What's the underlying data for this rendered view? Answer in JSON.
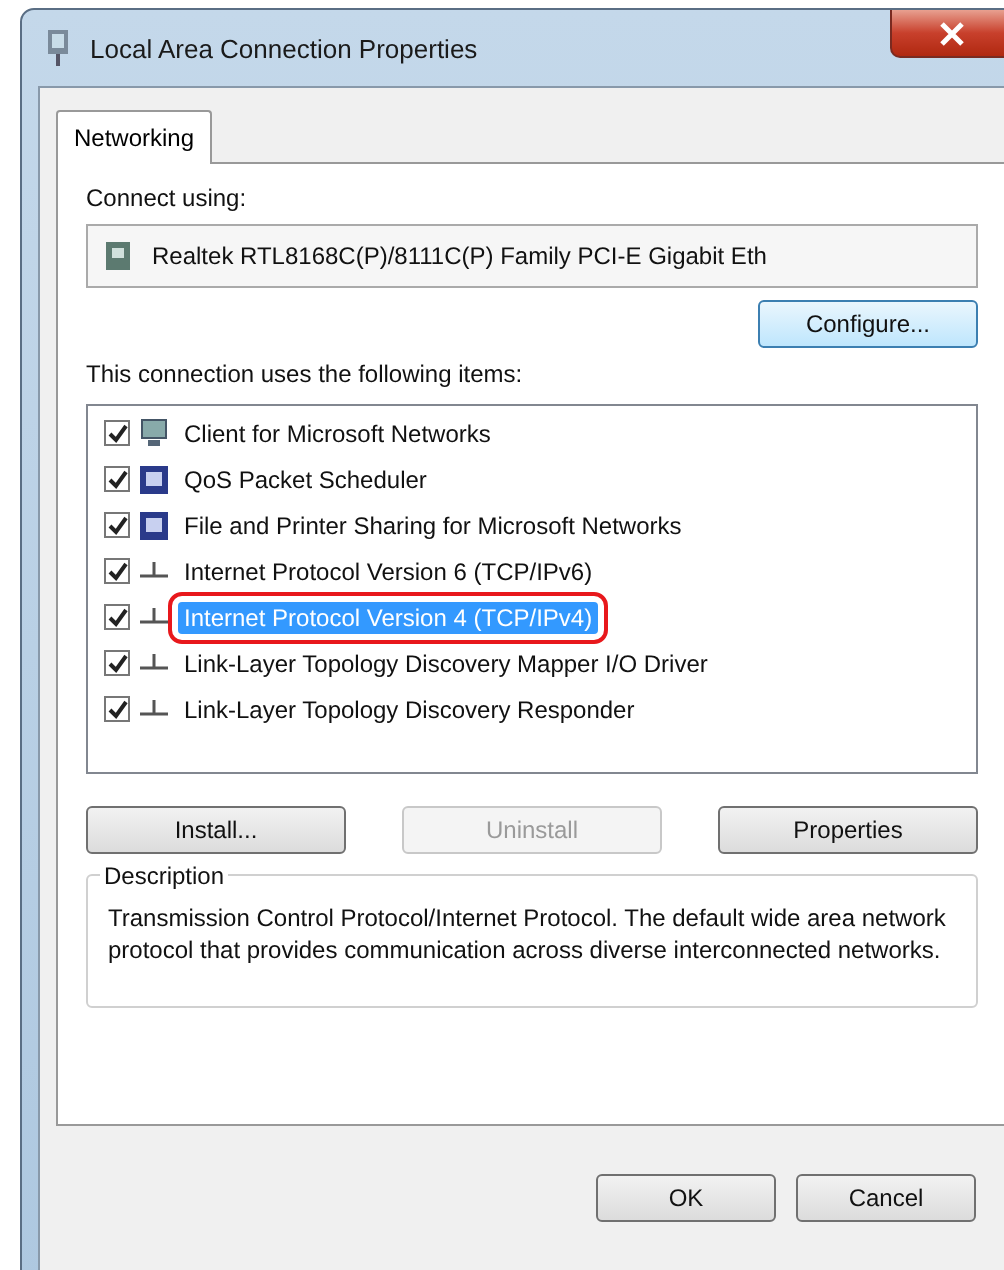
{
  "window": {
    "title": "Local Area Connection Properties"
  },
  "tabs": [
    {
      "label": "Networking",
      "selected": true
    }
  ],
  "connect_using": {
    "label": "Connect using:",
    "adapter": "Realtek RTL8168C(P)/8111C(P) Family PCI-E Gigabit Eth"
  },
  "configure_button": "Configure...",
  "items_label": "This connection uses the following items:",
  "items": [
    {
      "name": "Client for Microsoft Networks",
      "kind": "client",
      "checked": true,
      "selected": false,
      "annotated": false
    },
    {
      "name": "QoS Packet Scheduler",
      "kind": "service",
      "checked": true,
      "selected": false,
      "annotated": false
    },
    {
      "name": "File and Printer Sharing for Microsoft Networks",
      "kind": "service",
      "checked": true,
      "selected": false,
      "annotated": false
    },
    {
      "name": "Internet Protocol Version 6 (TCP/IPv6)",
      "kind": "protocol",
      "checked": true,
      "selected": false,
      "annotated": false
    },
    {
      "name": "Internet Protocol Version 4 (TCP/IPv4)",
      "kind": "protocol",
      "checked": true,
      "selected": true,
      "annotated": true
    },
    {
      "name": "Link-Layer Topology Discovery Mapper I/O Driver",
      "kind": "protocol",
      "checked": true,
      "selected": false,
      "annotated": false
    },
    {
      "name": "Link-Layer Topology Discovery Responder",
      "kind": "protocol",
      "checked": true,
      "selected": false,
      "annotated": false
    }
  ],
  "item_buttons": [
    {
      "label": "Install...",
      "disabled": false
    },
    {
      "label": "Uninstall",
      "disabled": true
    },
    {
      "label": "Properties",
      "disabled": false
    }
  ],
  "description": {
    "heading": "Description",
    "text": "Transmission Control Protocol/Internet Protocol. The default wide area network protocol that provides communication across diverse interconnected networks."
  },
  "dialog_buttons": [
    "OK",
    "Cancel"
  ]
}
